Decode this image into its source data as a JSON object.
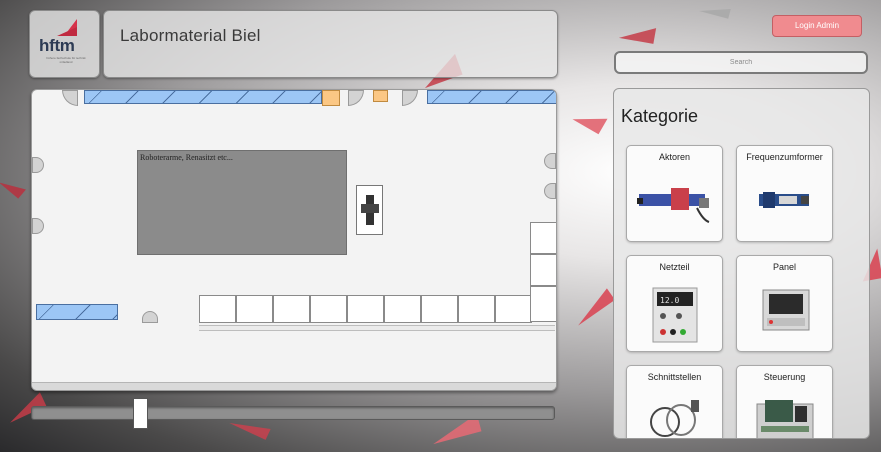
{
  "header": {
    "logo_text": "hftm",
    "logo_subtext": "höhere fachschule für technik mittelland",
    "title": "Labormaterial Biel"
  },
  "login": {
    "label": "Login Admin"
  },
  "search": {
    "placeholder": "Search"
  },
  "map": {
    "robot_area_label": "Roboterarme, Renasitzt etc..."
  },
  "slider": {
    "level": 0.2
  },
  "categories": {
    "title": "Kategorie",
    "items": [
      {
        "label": "Aktoren",
        "icon": "linear-actuator-image"
      },
      {
        "label": "Frequenzumformer",
        "icon": "frequency-converter-image"
      },
      {
        "label": "Netzteil",
        "icon": "power-supply-image"
      },
      {
        "label": "Panel",
        "icon": "operator-panel-image"
      },
      {
        "label": "Schnittstellen",
        "icon": "cables-image"
      },
      {
        "label": "Steuerung",
        "icon": "plc-controller-image"
      }
    ]
  },
  "colors": {
    "accent": "#f08b8f",
    "brand_red": "#d6324a",
    "brand_navy": "#2d3b54",
    "window_blue": "#9cc6f5",
    "orange": "#fbc784"
  }
}
